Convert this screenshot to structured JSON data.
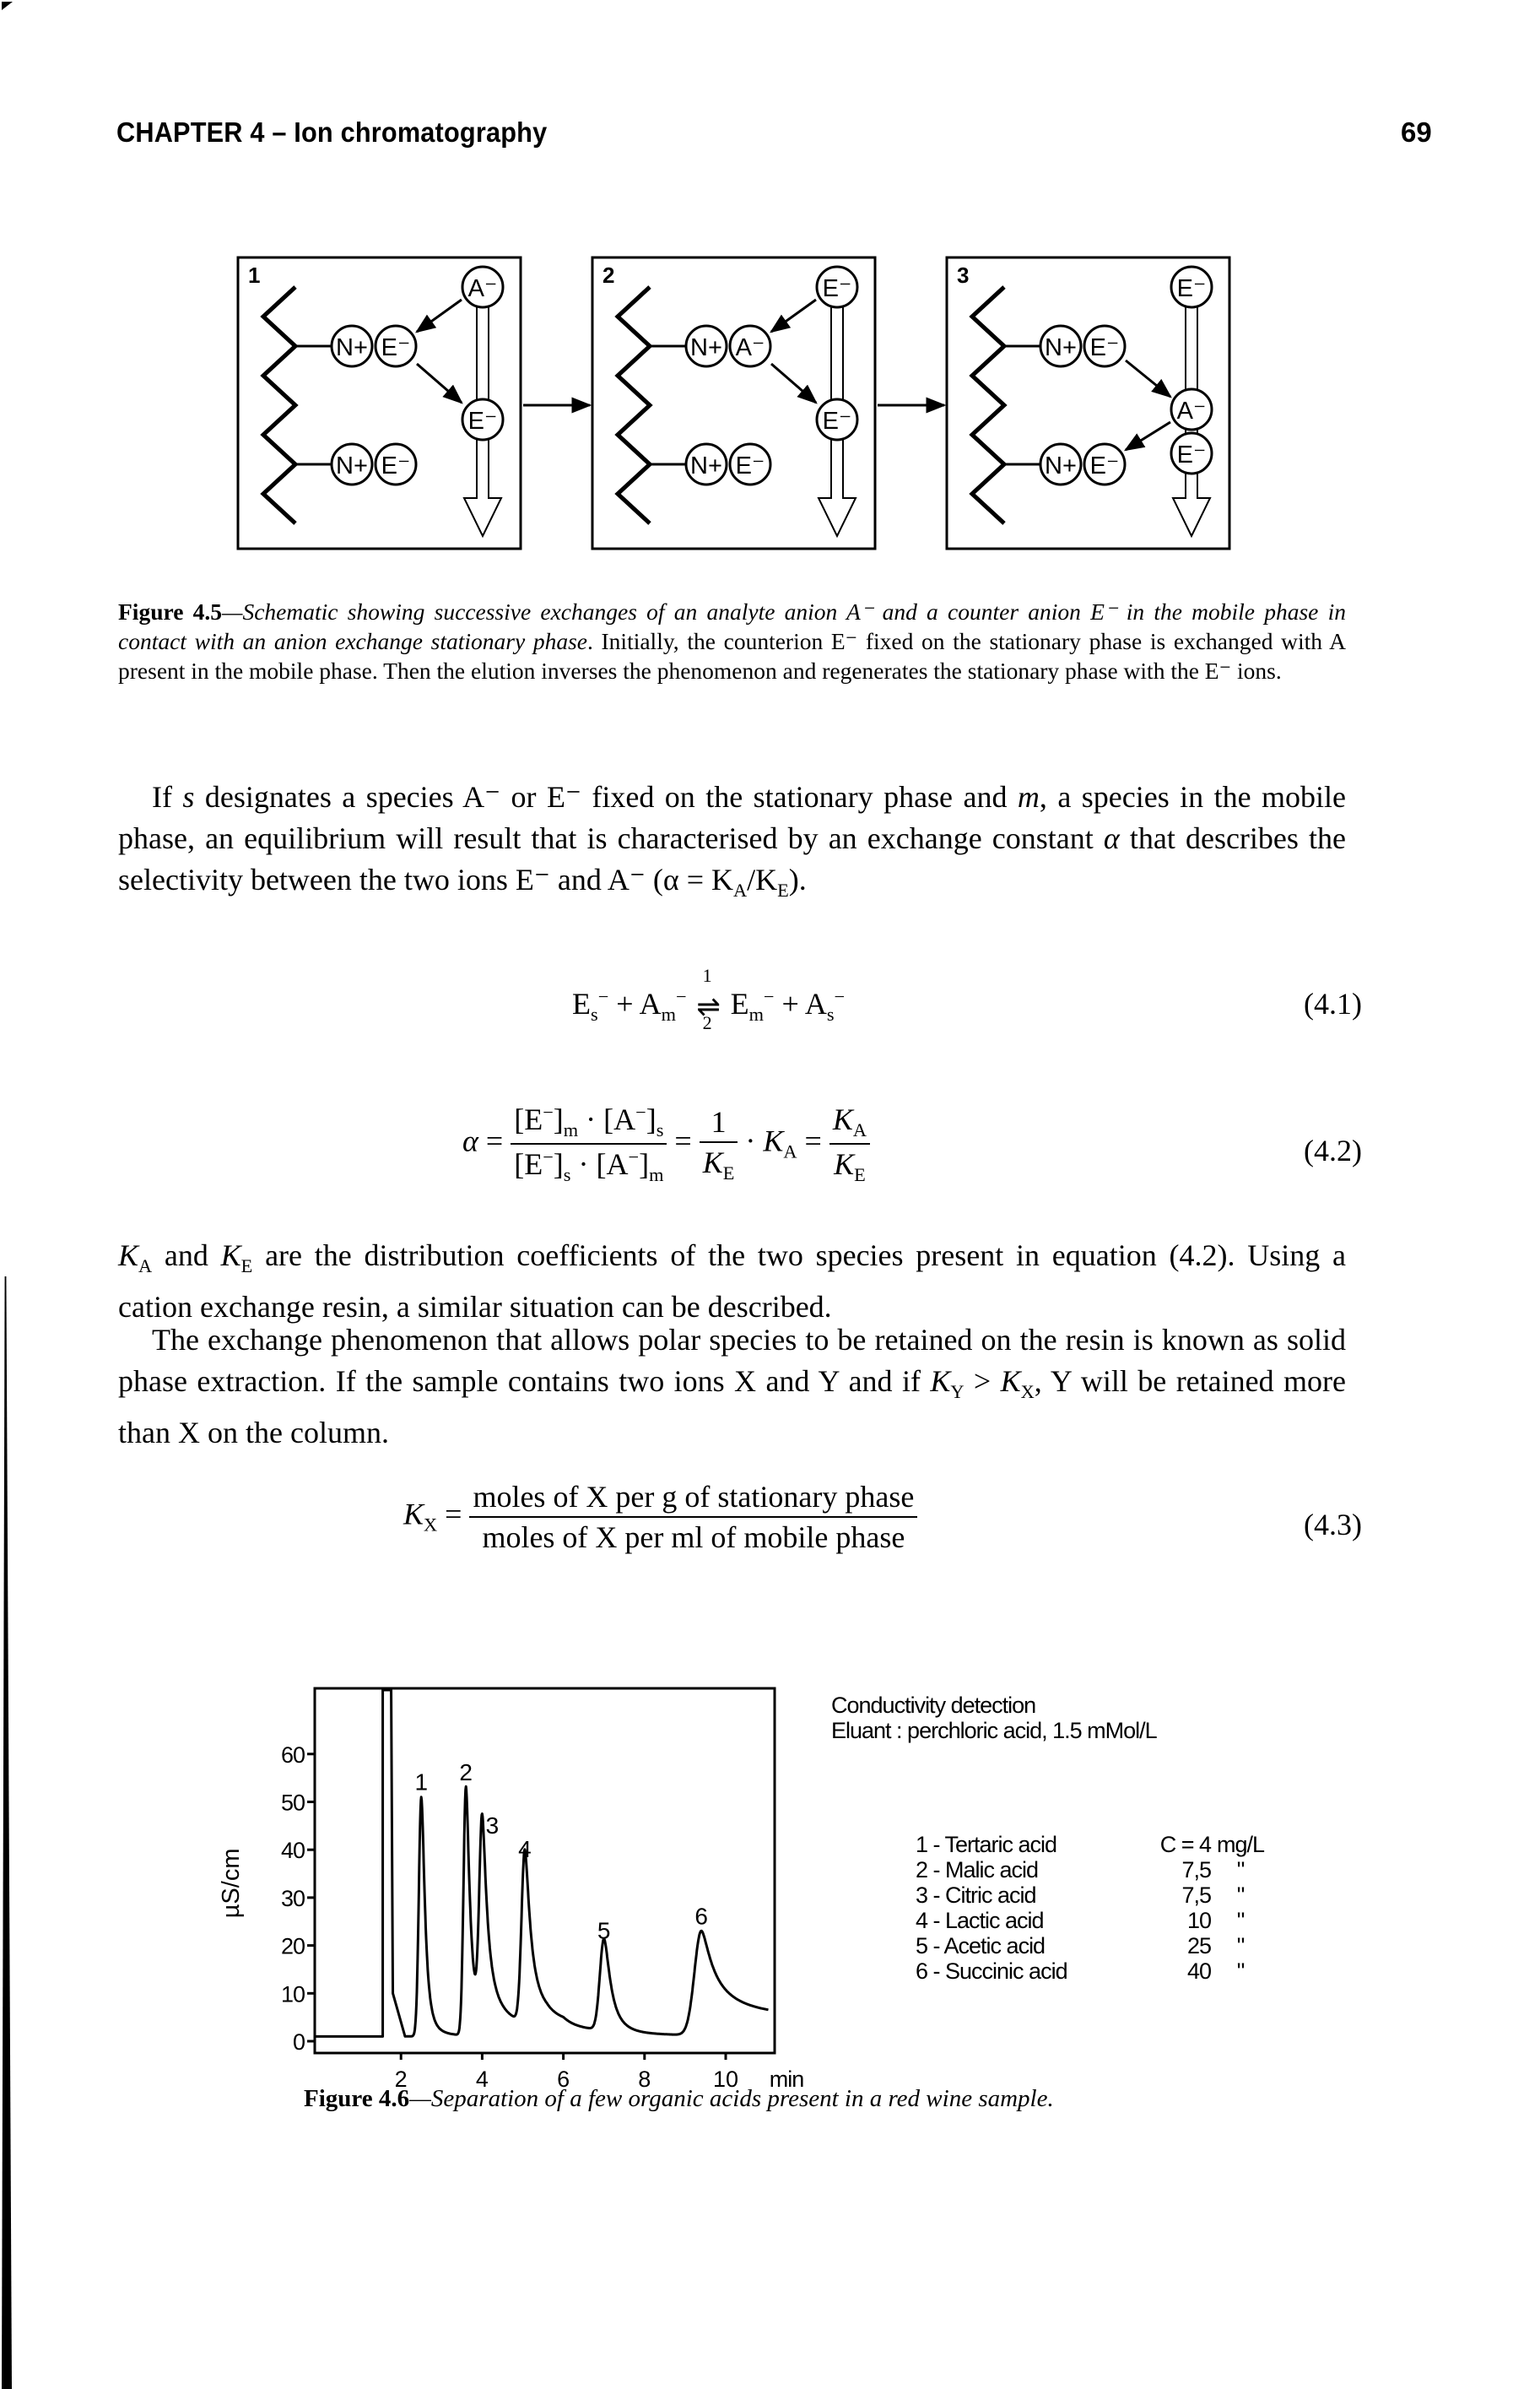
{
  "page": {
    "running_head": "CHAPTER 4 – Ion chromatography",
    "page_number": "69"
  },
  "figure_4_5": {
    "panels": [
      {
        "label": "1",
        "top_pair": [
          "N+",
          "E⁻"
        ],
        "bottom_pair": [
          "N+",
          "E⁻"
        ],
        "column_ions": [
          "A⁻",
          "E⁻"
        ]
      },
      {
        "label": "2",
        "top_pair": [
          "N+",
          "A⁻"
        ],
        "bottom_pair": [
          "N+",
          "E⁻"
        ],
        "column_ions": [
          "E⁻",
          "E⁻"
        ]
      },
      {
        "label": "3",
        "top_pair": [
          "N+",
          "E⁻"
        ],
        "bottom_pair": [
          "N+",
          "E⁻"
        ],
        "column_ions": [
          "E⁻",
          "A⁻",
          "E⁻"
        ]
      }
    ],
    "caption_label": "Figure 4.5",
    "caption_italic": "—Schematic showing successive exchanges of an analyte anion A⁻ and a counter anion E⁻ in the mobile phase in contact with an anion exchange stationary phase",
    "caption_rest": ". Initially, the counterion E⁻ fixed on the stationary phase is exchanged with A  present in the mobile phase. Then the elution inverses the phenomenon and regenerates the stationary phase with the E⁻ ions."
  },
  "paragraph_1": {
    "p1": "If ",
    "s": "s",
    "p2": " designates a species A⁻ or E⁻ fixed on the stationary phase and ",
    "m": "m",
    "p3": ", a species in the mobile phase, an equilibrium will result that is characterised by an exchange constant ",
    "alpha": "α",
    "p4": " that describes the selectivity between the two ions E⁻ and A⁻ (α = K",
    "sub_a": "A",
    "p5": "/K",
    "sub_e": "E",
    "p6": ")."
  },
  "equations": {
    "eq_4_1": {
      "number": "(4.1)",
      "forward": "1",
      "reverse": "2"
    },
    "eq_4_2": {
      "number": "(4.2)"
    },
    "eq_4_3": {
      "number": "(4.3)",
      "numerator": "moles of X per g of stationary phase",
      "denominator": "moles of X per ml of mobile phase"
    }
  },
  "paragraph_2": {
    "text1": " and ",
    "text2": " are the distribution coefficients of the two species present in equation (4.2). Using a cation exchange resin, a similar situation can be described."
  },
  "paragraph_3": {
    "text1": "The exchange phenomenon that allows polar species to be retained on the resin is known as solid phase extraction. If the sample contains two ions X and Y and if ",
    "text2": ", Y will be retained more than X on the column."
  },
  "figure_4_6": {
    "caption_label": "Figure 4.6",
    "caption_italic": "—Separation of a few organic acids present in a red wine sample.",
    "conditions": [
      "Conductivity detection",
      "Eluant : perchloric acid, 1.5 mMol/L"
    ],
    "legend": [
      {
        "name": "1 - Tertaric  acid",
        "conc": "C = 4",
        "unit": "mg/L"
      },
      {
        "name": "2 - Malic acid",
        "conc": "7,5",
        "unit": "\""
      },
      {
        "name": "3 - Citric acid",
        "conc": "7,5",
        "unit": "\""
      },
      {
        "name": "4 - Lactic acid",
        "conc": "10",
        "unit": "\""
      },
      {
        "name": "5 - Acetic acid",
        "conc": "25",
        "unit": "\""
      },
      {
        "name": "6 - Succinic acid",
        "conc": "40",
        "unit": "\""
      }
    ]
  },
  "chart_data": {
    "type": "line",
    "title": "",
    "xlabel": "min",
    "ylabel": "µS/cm",
    "xlim": [
      0,
      11.2
    ],
    "ylim": [
      -1.5,
      66
    ],
    "x_ticks": [
      2,
      4,
      6,
      8,
      10
    ],
    "y_ticks": [
      0,
      10,
      20,
      30,
      40,
      50,
      60
    ],
    "grid": false,
    "baseline": 1,
    "solvent_front": {
      "x": 1.55,
      "note": "off-scale"
    },
    "peaks": [
      {
        "label": "1",
        "time": 2.5,
        "height": 50,
        "width": 0.06,
        "tail": 0.25
      },
      {
        "label": "2",
        "time": 3.6,
        "height": 52,
        "width": 0.06,
        "tail": 0.3
      },
      {
        "label": "3",
        "time": 4.0,
        "height": 42,
        "width": 0.07,
        "tail": 0.35
      },
      {
        "label": "4",
        "time": 5.05,
        "height": 36,
        "width": 0.08,
        "tail": 0.35
      },
      {
        "label": "5",
        "time": 7.0,
        "height": 19,
        "width": 0.1,
        "tail": 0.3
      },
      {
        "label": "6",
        "time": 9.4,
        "height": 22,
        "width": 0.17,
        "tail": 0.5
      }
    ]
  }
}
